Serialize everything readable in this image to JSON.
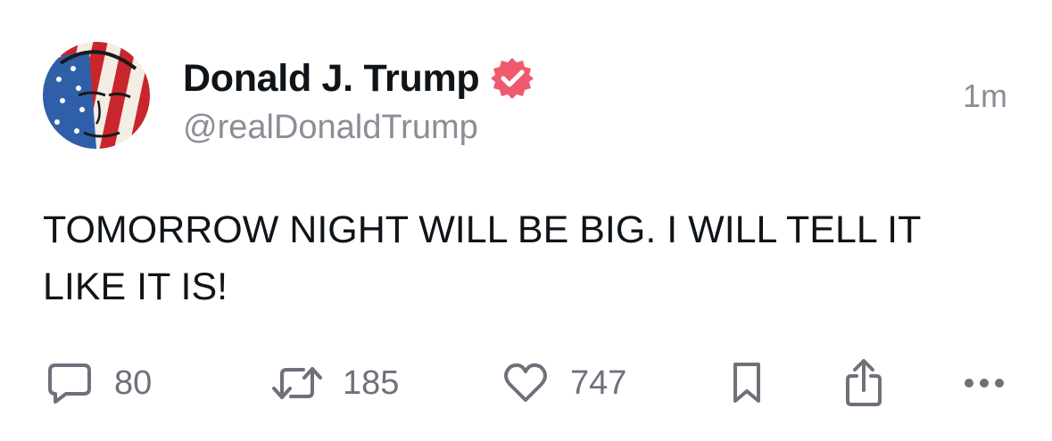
{
  "post": {
    "author": {
      "display_name": "Donald J. Trump",
      "handle": "@realDonaldTrump",
      "verified": true,
      "avatar_icon": "flag-portrait-avatar"
    },
    "timestamp": "1m",
    "text": "TOMORROW NIGHT WILL BE BIG. I WILL TELL IT\nLIKE IT IS!",
    "actions": {
      "replies": "80",
      "reposts": "185",
      "likes": "747"
    }
  },
  "colors": {
    "verified_badge": "#ef5a6f",
    "muted_text": "#8b8e96",
    "action_icons": "#6e717a"
  }
}
